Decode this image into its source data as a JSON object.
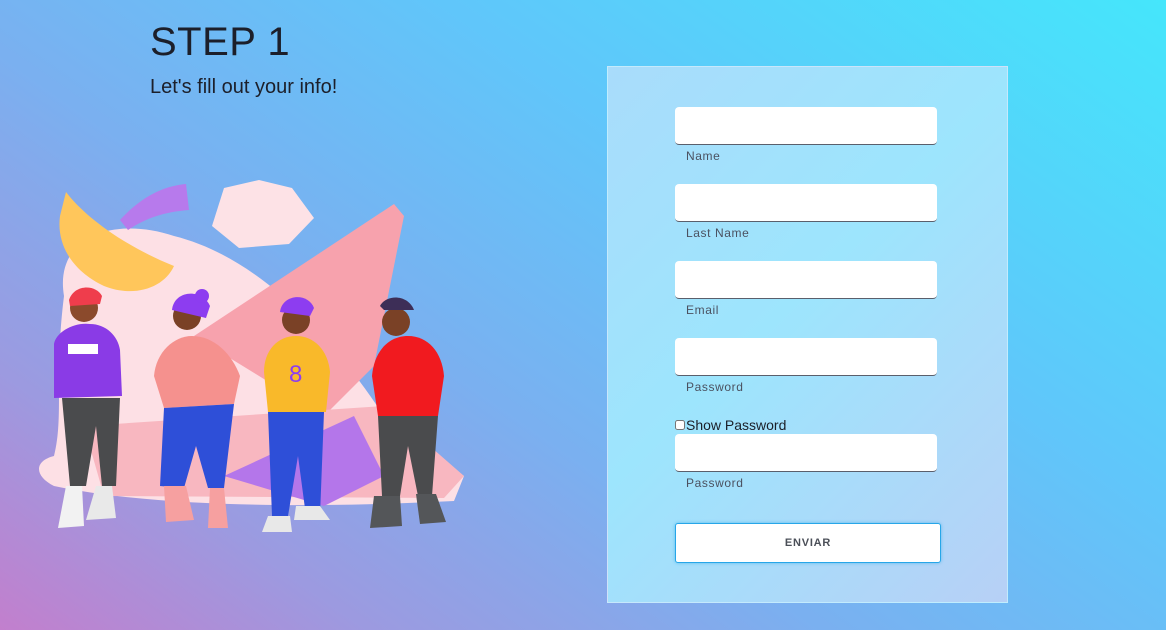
{
  "header": {
    "title": "STEP 1",
    "subtitle": "Let's fill out your info!"
  },
  "illustration": {
    "icon": "people-group-illustration"
  },
  "form": {
    "fields": [
      {
        "label": "Name",
        "value": ""
      },
      {
        "label": "Last Name",
        "value": ""
      },
      {
        "label": "Email",
        "value": ""
      },
      {
        "label": "Password",
        "value": ""
      },
      {
        "label": "Password",
        "value": ""
      }
    ],
    "show_password_label": "Show Password",
    "show_password_checked": false,
    "submit_label": "ENVIAR"
  },
  "colors": {
    "background_start": "#c27fcd",
    "background_end": "#45e6fb",
    "button_border": "#27a6e8"
  }
}
